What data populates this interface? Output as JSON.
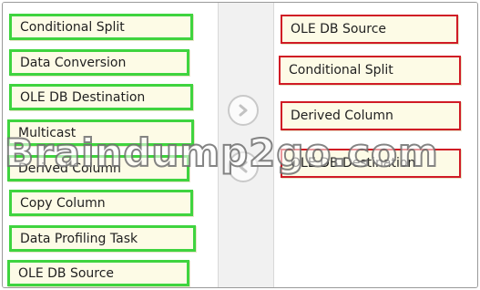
{
  "left_list": {
    "items": [
      "Conditional Split",
      "Data Conversion",
      "OLE DB Destination",
      "Multicast",
      "Derived Column",
      "Copy Column",
      "Data Profiling Task",
      "OLE DB Source"
    ]
  },
  "right_list": {
    "items": [
      "OLE DB Source",
      "Conditional Split",
      "Derived Column",
      "OLE DB Destination"
    ]
  },
  "buttons": {
    "move_right_icon": "chevron-right-icon",
    "move_left_icon": "chevron-left-icon"
  },
  "watermark": {
    "text": "Braindump2go.com"
  },
  "colors": {
    "left_border": "#3fd43f",
    "right_border": "#d01b25",
    "item_background": "#fdfbe6"
  }
}
